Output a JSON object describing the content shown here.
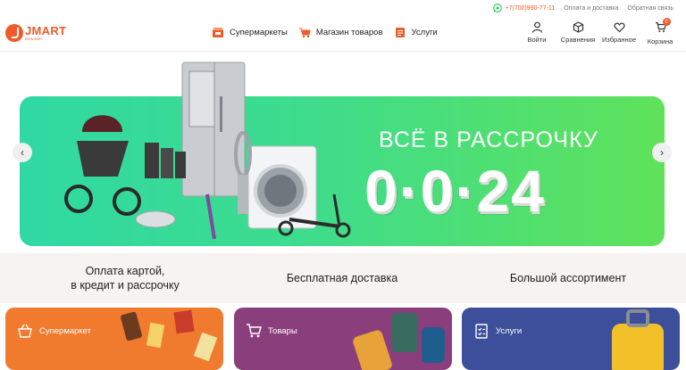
{
  "topbar": {
    "phone": "+7(700)990-77-11",
    "links": [
      "Оплата и доставка",
      "Обратная связь"
    ]
  },
  "logo": {
    "name": "JMART",
    "slogan": "есть всё!"
  },
  "nav": [
    {
      "label": "Супермаркеты",
      "icon": "supermarket-icon"
    },
    {
      "label": "Магазин товаров",
      "icon": "cart-icon"
    },
    {
      "label": "Услуги",
      "icon": "services-icon"
    }
  ],
  "actions": [
    {
      "label": "Войти",
      "icon": "user-icon"
    },
    {
      "label": "Сравнения",
      "icon": "compare-icon"
    },
    {
      "label": "Избранное",
      "icon": "heart-icon"
    },
    {
      "label": "Корзина",
      "icon": "cart-icon",
      "badge": "0"
    }
  ],
  "banner": {
    "title": "ВСЁ В РАССРОЧКУ",
    "big": "0·0·24",
    "prev": "‹",
    "next": "›"
  },
  "features": [
    {
      "line1": "Оплата картой,",
      "line2": "в кредит и рассрочку"
    },
    {
      "line1": "Бесплатная доставка",
      "line2": ""
    },
    {
      "line1": "Большой ассортимент",
      "line2": ""
    }
  ],
  "categories": [
    {
      "label": "Супермаркет",
      "color": "#f07a2e"
    },
    {
      "label": "Товары",
      "color": "#8a3f7c"
    },
    {
      "label": "Услуги",
      "color": "#3d4f9a"
    }
  ],
  "colors": {
    "accent": "#ef5b2a",
    "banner_start": "#30d9a3",
    "banner_end": "#5fe25a"
  }
}
